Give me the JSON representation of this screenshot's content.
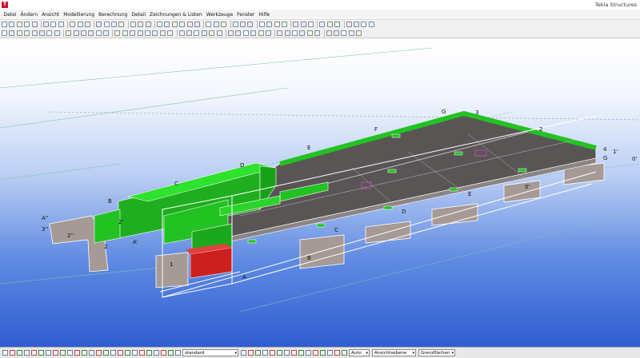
{
  "window": {
    "title": "Tekla Structures",
    "app_icon_glyph": "T"
  },
  "menu": [
    "Datei",
    "Ändern",
    "Ansicht",
    "Modellierung",
    "Berechnung",
    "Detail",
    "Zeichnungen & Listen",
    "Werkzeuge",
    "Fenster",
    "Hilfe"
  ],
  "colors": {
    "accent": "#c8102e",
    "slab": "#5a5555",
    "wall": "#22c222",
    "beam": "#a69a96",
    "highlight": "#cc1f1f"
  },
  "grid_labels": {
    "g": "G",
    "three": "3",
    "f": "F",
    "two_a": "2",
    "e": "E",
    "d": "D",
    "c": "C",
    "b": "B",
    "a_prime_prime": "A''",
    "three_prime_prime": "3''",
    "two_prime_prime": "2''",
    "two_prime": "2'",
    "a_prime": "A'",
    "two_b": "2",
    "one": "1",
    "a": "A",
    "g_right": "G",
    "one_prime": "1'",
    "zero_prime": "0'",
    "four": "4",
    "b_small": "B",
    "c_small": "C",
    "d_small": "D",
    "e_small": "E",
    "zero_prime_b": "0'"
  },
  "statusbar": {
    "view_combo": "standard",
    "snap_combo": "Auto",
    "plane_combo": "Ansichtsebene",
    "filter_combo": "Grenzflächen"
  }
}
